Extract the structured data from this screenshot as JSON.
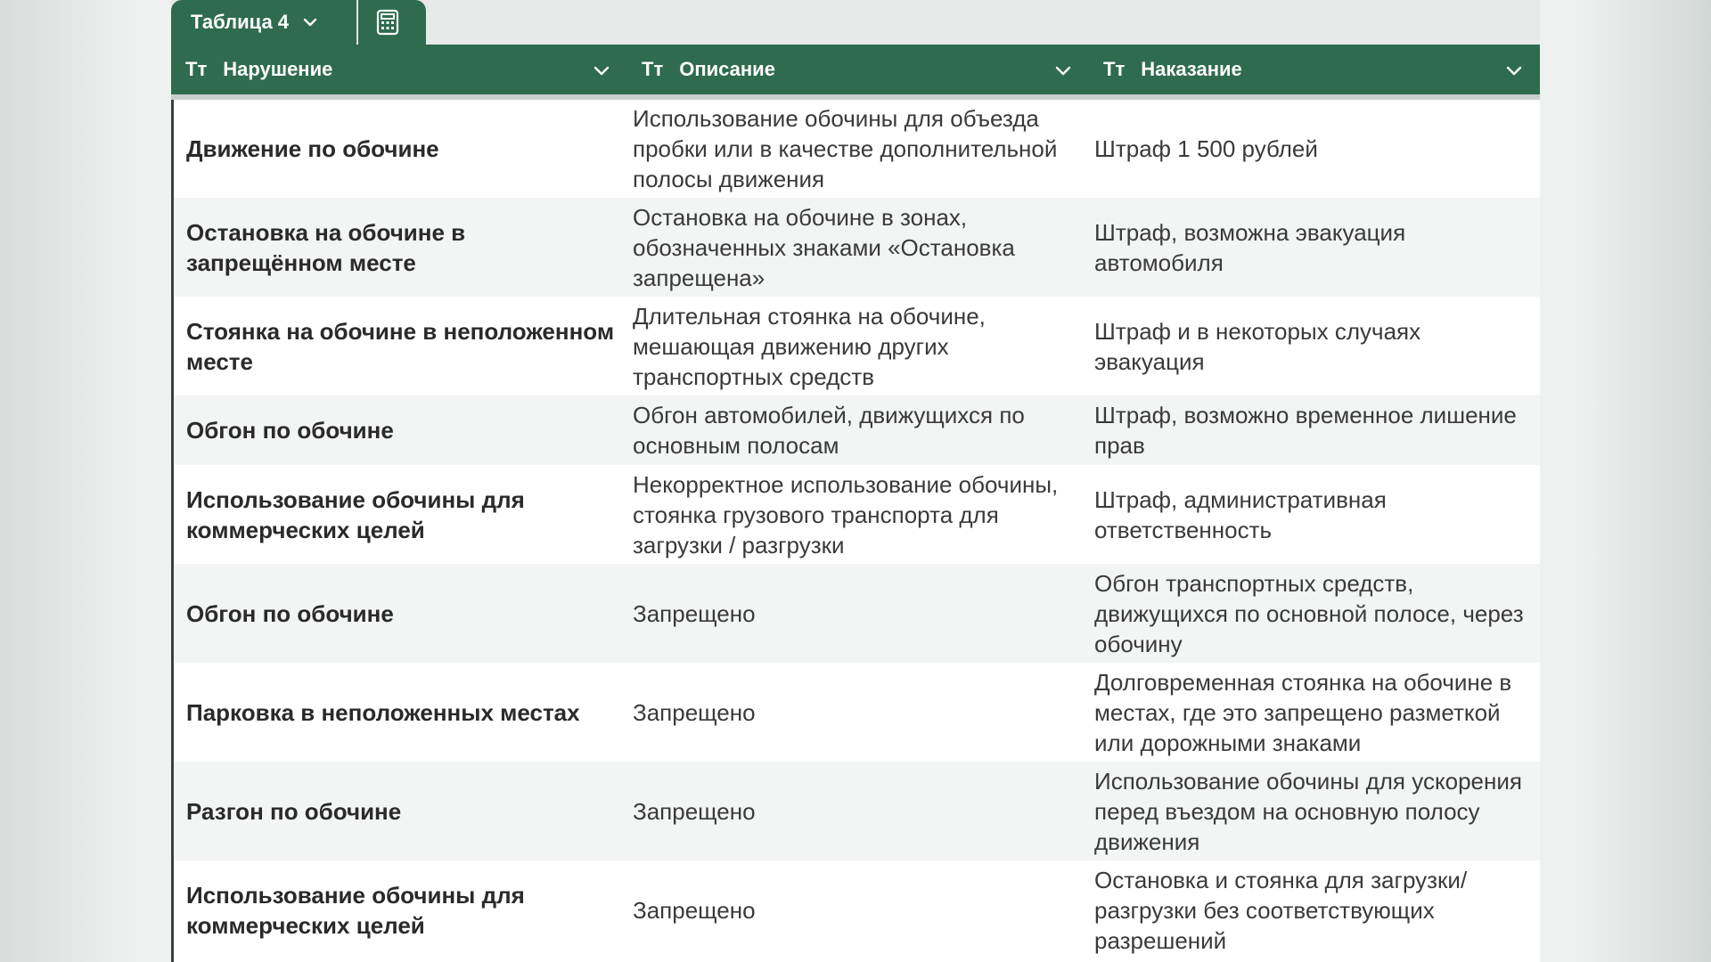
{
  "tab": {
    "label": "Таблица 4"
  },
  "columns": [
    {
      "type_icon": "Тт",
      "label": "Нарушение"
    },
    {
      "type_icon": "Тт",
      "label": "Описание"
    },
    {
      "type_icon": "Тт",
      "label": "Наказание"
    }
  ],
  "rows": [
    {
      "violation": "Движение по обочине",
      "description": "Использование обочины для объезда пробки или в качестве дополнительной полосы движения",
      "penalty": "Штраф 1 500 рублей"
    },
    {
      "violation": "Остановка на обочине в запрещённом месте",
      "description": "Остановка на обочине в зонах, обозначенных знаками «Остановка запрещена»",
      "penalty": "Штраф, возможна эвакуация автомобиля"
    },
    {
      "violation": "Стоянка на обочине в неположенном месте",
      "description": "Длительная стоянка на обочине, мешающая движению других транспортных средств",
      "penalty": "Штраф и в некоторых случаях эвакуация"
    },
    {
      "violation": "Обгон по обочине",
      "description": "Обгон автомобилей, движущихся по основным полосам",
      "penalty": "Штраф, возможно временное лишение прав"
    },
    {
      "violation": "Использование обочины для коммерческих целей",
      "description": "Некорректное использование обочины, стоянка грузового транспорта для загрузки / разгрузки",
      "penalty": "Штраф, административная ответственность"
    },
    {
      "violation": "Обгон по обочине",
      "description": "Запрещено",
      "penalty": "Обгон транспортных средств, движущихся по основной полосе, через обочину"
    },
    {
      "violation": "Парковка в неположенных местах",
      "description": "Запрещено",
      "penalty": "Долговременная стоянка на обочине в местах, где это запрещено разметкой или дорожными знаками"
    },
    {
      "violation": "Разгон по обочине",
      "description": "Запрещено",
      "penalty": "Использование обочины для ускорения перед въездом на основную полосу движения"
    },
    {
      "violation": "Использование обочины для коммерческих целей",
      "description": "Запрещено",
      "penalty": "Остановка и стоянка для загрузки/разгрузки без соответствующих разрешений"
    }
  ],
  "colors": {
    "header_bg": "#2f6b4e",
    "header_text": "#ffffff",
    "alt_row": "#f3f4f4"
  }
}
